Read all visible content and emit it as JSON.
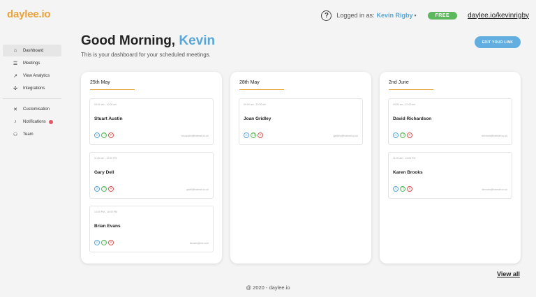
{
  "app": {
    "logo": "daylee.io"
  },
  "topbar": {
    "help_symbol": "?",
    "logged_in_prefix": "Logged in as:",
    "user_name": "Kevin Rigby",
    "caret": "▾",
    "plan_badge": "FREE",
    "profile_link": "daylee.io/kevinrigby"
  },
  "sidebar": {
    "items": [
      {
        "label": "Dashboard",
        "icon": "home-icon",
        "glyph": "⌂",
        "active": true
      },
      {
        "label": "Meetings",
        "icon": "list-icon",
        "glyph": "☰"
      },
      {
        "label": "View Analytics",
        "icon": "analytics-icon",
        "glyph": "↗"
      },
      {
        "label": "Integrations",
        "icon": "puzzle-icon",
        "glyph": "✣"
      },
      {
        "label": "Customisation",
        "icon": "tools-icon",
        "glyph": "✕"
      },
      {
        "label": "Notifications",
        "icon": "bell-icon",
        "glyph": "♪"
      },
      {
        "label": "Team",
        "icon": "team-icon",
        "glyph": "⚇"
      }
    ]
  },
  "header": {
    "greeting_prefix": "Good Morning,",
    "greeting_name": "Kevin",
    "subtitle": "This is your dashboard for your scheduled meetings.",
    "edit_button": "EDIT YOUR LINK"
  },
  "columns": [
    {
      "date": "25th May",
      "meetings": [
        {
          "time": "09:00 am - 10:00 am",
          "name": "Stuart Austin",
          "email": "stu.austin@hotmail.co.uk"
        },
        {
          "time": "11:00 am - 12:00 PM",
          "name": "Gary Dell",
          "email": "gdell@hotmail.co.uk"
        },
        {
          "time": "13:00 PM - 16:00 PM",
          "name": "Brian Evans",
          "email": "bevans@me.com"
        }
      ]
    },
    {
      "date": "28th May",
      "meetings": [
        {
          "time": "09:00 am - 10:00 am",
          "name": "Joan Gridley",
          "email": "jgridley@hotmail.co.uk"
        }
      ]
    },
    {
      "date": "2nd June",
      "meetings": [
        {
          "time": "09:00 am - 10:00 am",
          "name": "David Richardson",
          "email": "drichard@hotmail.co.uk"
        },
        {
          "time": "11:00 am - 12:00 PM",
          "name": "Karen Brooks",
          "email": "kbrooks@hotmail.co.uk"
        }
      ]
    }
  ],
  "action_glyphs": {
    "user": "♙",
    "copy": "❐",
    "cancel": "✕"
  },
  "view_all": "View all",
  "footer": "@ 2020 - daylee.io",
  "colors": {
    "brand_orange": "#e8a33d",
    "accent_blue": "#58a7d8",
    "badge_green": "#5cb85c",
    "notification_red": "#e05a6a"
  }
}
